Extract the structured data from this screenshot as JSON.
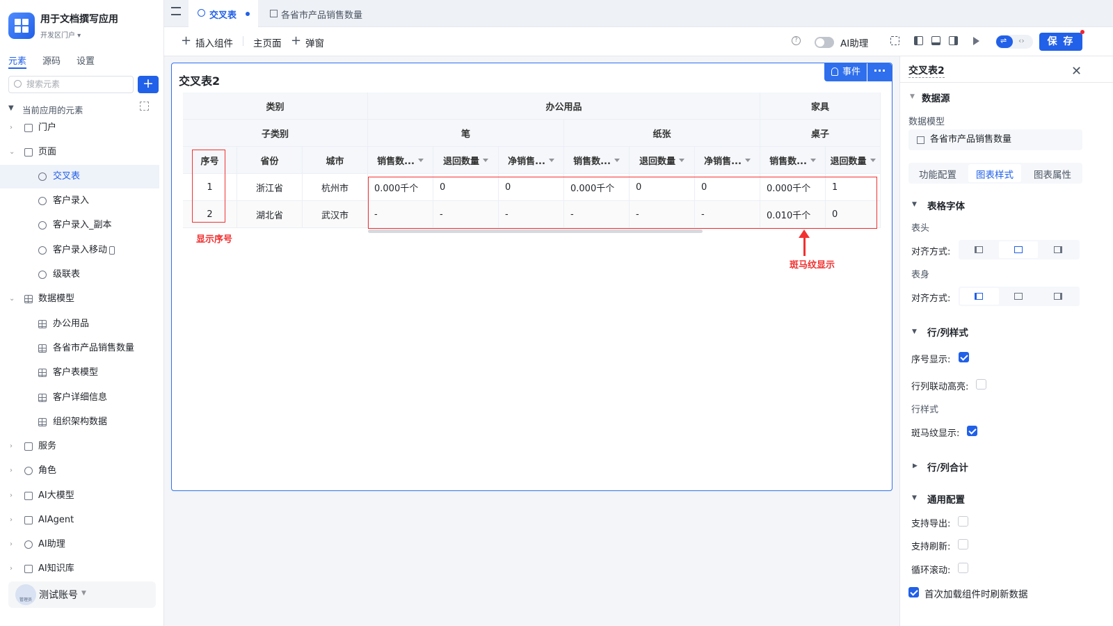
{
  "app": {
    "title": "用于文档撰写应用",
    "subtitle": "开发区门户 ▾"
  },
  "sidebar": {
    "tabs": [
      "元素",
      "源码",
      "设置"
    ],
    "search_placeholder": "搜索元素",
    "add_label": "+",
    "section_title": "当前应用的元素",
    "items": [
      {
        "label": "门户"
      },
      {
        "label": "页面"
      },
      {
        "label": "交叉表"
      },
      {
        "label": "客户录入"
      },
      {
        "label": "客户录入_副本"
      },
      {
        "label": "客户录入移动"
      },
      {
        "label": "级联表"
      },
      {
        "label": "数据模型"
      },
      {
        "label": "办公用品"
      },
      {
        "label": "各省市产品销售数量"
      },
      {
        "label": "客户表模型"
      },
      {
        "label": "客户详细信息"
      },
      {
        "label": "组织架构数据"
      },
      {
        "label": "服务"
      },
      {
        "label": "角色"
      },
      {
        "label": "AI大模型"
      },
      {
        "label": "AIAgent"
      },
      {
        "label": "AI助理"
      },
      {
        "label": "AI知识库"
      }
    ],
    "account": {
      "name": "测试账号",
      "role": "管理员"
    }
  },
  "tabs": {
    "active": "交叉表",
    "second": "各省市产品销售数量"
  },
  "toolbar": {
    "insert": "插入组件",
    "main_page": "主页面",
    "popup": "弹窗",
    "ai_assistant": "AI助理",
    "save": "保 存"
  },
  "canvas": {
    "title": "交叉表2",
    "event_btn": "事件",
    "more_btn": "···",
    "table": {
      "row1": [
        "类别",
        "办公用品",
        "家具"
      ],
      "row2": [
        "子类别",
        "笔",
        "纸张",
        "桌子"
      ],
      "row3": [
        "序号",
        "省份",
        "城市",
        "销售数...",
        "退回数量",
        "净销售...",
        "销售数...",
        "退回数量",
        "净销售...",
        "销售数...",
        "退回数量"
      ],
      "rows": [
        [
          "1",
          "浙江省",
          "杭州市",
          "0.000千个",
          "0",
          "0",
          "0.000千个",
          "0",
          "0",
          "0.000千个",
          "1"
        ],
        [
          "2",
          "湖北省",
          "武汉市",
          "-",
          "-",
          "-",
          "-",
          "-",
          "-",
          "0.010千个",
          "0"
        ]
      ]
    },
    "annotations": {
      "index": "显示序号",
      "zebra": "斑马纹显示"
    }
  },
  "panel": {
    "title": "交叉表2",
    "datasource_section": "数据源",
    "data_model_label": "数据模型",
    "data_model_value": "各省市产品销售数量",
    "tabs": [
      "功能配置",
      "图表样式",
      "图表属性"
    ],
    "table_font_section": "表格字体",
    "header_label": "表头",
    "align_label": "对齐方式:",
    "body_label": "表身",
    "row_col_section": "行/列样式",
    "index_display": "序号显示:",
    "linked_highlight": "行列联动高亮:",
    "row_style": "行样式",
    "zebra_display": "斑马纹显示:",
    "totals_section": "行/列合计",
    "general_section": "通用配置",
    "export_label": "支持导出:",
    "refresh_label": "支持刷新:",
    "loop_label": "循环滚动:",
    "first_load": "首次加载组件时刷新数据"
  }
}
